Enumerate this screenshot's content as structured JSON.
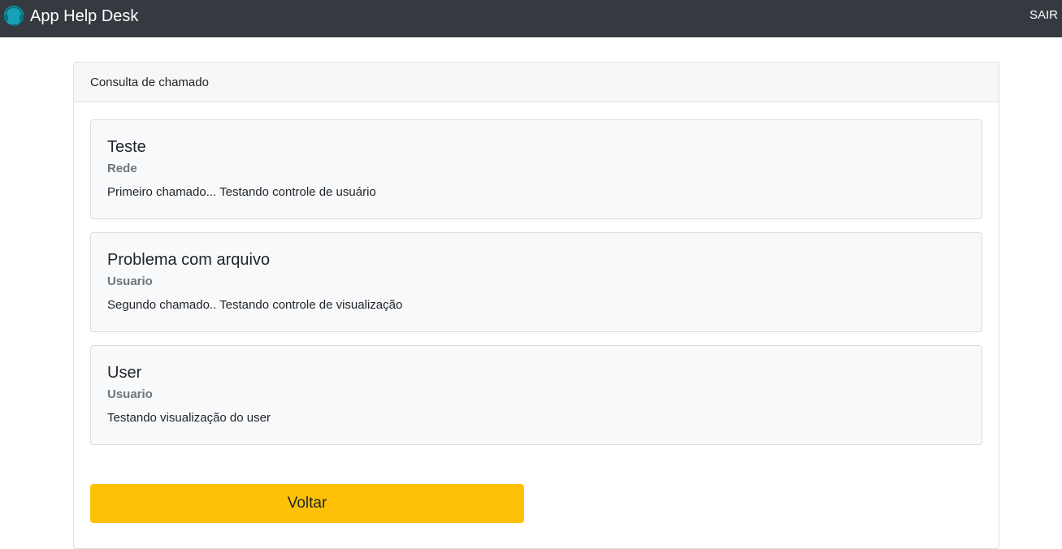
{
  "navbar": {
    "brand": "App Help Desk",
    "logo_icon": "headset-icon",
    "exit_label": "SAIR",
    "background": "#343a40"
  },
  "card": {
    "header": "Consulta de chamado"
  },
  "tickets": [
    {
      "title": "Teste",
      "category": "Rede",
      "description": "Primeiro chamado... Testando controle de usuário"
    },
    {
      "title": "Problema com arquivo",
      "category": "Usuario",
      "description": "Segundo chamado.. Testando controle de visualização"
    },
    {
      "title": "User",
      "category": "Usuario",
      "description": "Testando visualização do user"
    }
  ],
  "actions": {
    "back_label": "Voltar",
    "back_color": "#ffc107"
  }
}
